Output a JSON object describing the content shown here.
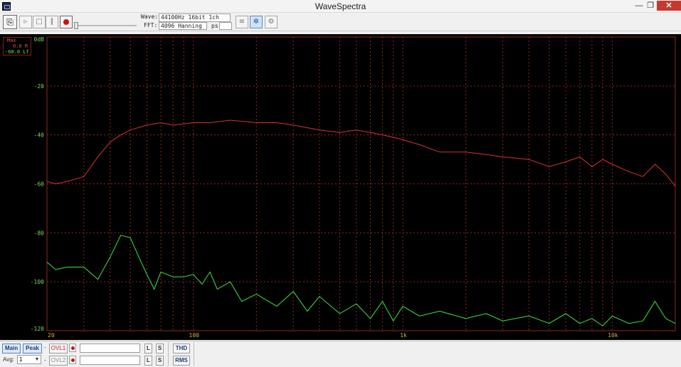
{
  "window": {
    "title": "WaveSpectra"
  },
  "toolbar": {
    "wave_label": "Wave:",
    "wave_value": "44100Hz 16bit 1ch",
    "fft_label": "FFT:",
    "fft_value": "4096 Hanning",
    "ps_label": "ps:",
    "ps_value": ""
  },
  "legend": {
    "title": "Max",
    "right": "0.0 R",
    "left": "-68.0 Lf"
  },
  "status": {
    "main_label": "Main",
    "peak_label": "Peak",
    "avg_label": "Avg:",
    "avg_value": "1",
    "ovl1": "OVL1",
    "ovl2": "OVL2",
    "l_label": "L",
    "s_label": "S",
    "thd_label": "THD",
    "rms_label": "RMS",
    "dash": "-"
  },
  "colors": {
    "grid": "#8a2a1c",
    "red_trace": "#d83232",
    "green_trace": "#3fe63f",
    "label": "#d8b030"
  },
  "chart_data": {
    "type": "line",
    "xscale": "log",
    "xlim": [
      20,
      20000
    ],
    "ylim": [
      -120,
      0
    ],
    "x_tick_labels": [
      {
        "x": 20,
        "label": "20"
      },
      {
        "x": 100,
        "label": "100"
      },
      {
        "x": 1000,
        "label": "1k"
      },
      {
        "x": 10000,
        "label": "10k"
      }
    ],
    "y_tick_labels": [
      {
        "y": 0,
        "label": "0dB"
      },
      {
        "y": -20,
        "label": "-20"
      },
      {
        "y": -40,
        "label": "-40"
      },
      {
        "y": -60,
        "label": "-60"
      },
      {
        "y": -80,
        "label": "-80"
      },
      {
        "y": -100,
        "label": "-100"
      },
      {
        "y": -120,
        "label": "-120"
      }
    ],
    "series": [
      {
        "color": "#d83232",
        "x": [
          20,
          22,
          25,
          30,
          35,
          40,
          45,
          50,
          60,
          70,
          80,
          100,
          120,
          150,
          200,
          250,
          300,
          400,
          500,
          600,
          700,
          800,
          900,
          1000,
          1200,
          1500,
          2000,
          2500,
          3000,
          4000,
          5000,
          6000,
          7000,
          8000,
          9000,
          10000,
          12000,
          14000,
          16000,
          18000,
          20000
        ],
        "y": [
          -59,
          -60,
          -59,
          -57,
          -49,
          -43,
          -40,
          -38,
          -36,
          -35,
          -36,
          -35,
          -35,
          -34,
          -35,
          -35,
          -36,
          -38,
          -39,
          -38,
          -39,
          -40,
          -41,
          -42,
          -44,
          -47,
          -47,
          -48,
          -49,
          -50,
          -53,
          -51,
          -49,
          -53,
          -50,
          -52,
          -55,
          -57,
          -52,
          -56,
          -61
        ]
      },
      {
        "color": "#3fe63f",
        "x": [
          20,
          22,
          25,
          30,
          35,
          40,
          45,
          50,
          55,
          60,
          65,
          70,
          80,
          90,
          100,
          110,
          120,
          130,
          150,
          170,
          200,
          250,
          300,
          350,
          400,
          500,
          600,
          700,
          800,
          900,
          1000,
          1200,
          1500,
          2000,
          2500,
          3000,
          4000,
          5000,
          6000,
          7000,
          8000,
          9000,
          10000,
          12000,
          14000,
          16000,
          18000,
          20000
        ],
        "y": [
          -92,
          -95,
          -94,
          -94,
          -99,
          -90,
          -81,
          -82,
          -90,
          -97,
          -103,
          -96,
          -98,
          -98,
          -97,
          -101,
          -96,
          -103,
          -100,
          -108,
          -105,
          -110,
          -104,
          -112,
          -106,
          -113,
          -109,
          -115,
          -108,
          -116,
          -110,
          -114,
          -112,
          -115,
          -113,
          -116,
          -114,
          -117,
          -113,
          -117,
          -115,
          -118,
          -114,
          -117,
          -116,
          -108,
          -115,
          -117
        ]
      }
    ]
  }
}
